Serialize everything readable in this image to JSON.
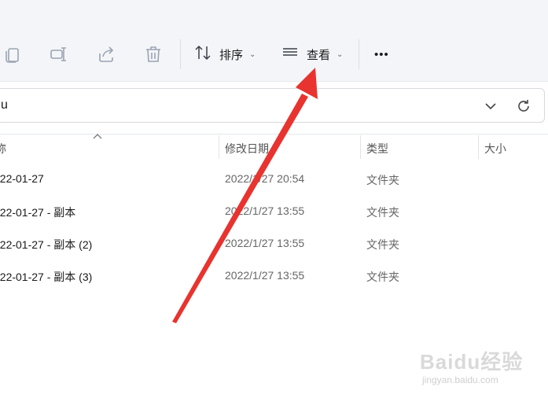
{
  "toolbar": {
    "sort_label": "排序",
    "view_label": "查看",
    "more_label": "•••"
  },
  "address_bar": {
    "path_text": "u"
  },
  "columns": {
    "name_label": "称",
    "date_label": "修改日期",
    "type_label": "类型",
    "size_label": "大小"
  },
  "files": [
    {
      "name": "022-01-27",
      "modified": "2022/1/27 20:54",
      "type": "文件夹"
    },
    {
      "name": "022-01-27 - 副本",
      "modified": "2022/1/27 13:55",
      "type": "文件夹"
    },
    {
      "name": "022-01-27 - 副本 (2)",
      "modified": "2022/1/27 13:55",
      "type": "文件夹"
    },
    {
      "name": "022-01-27 - 副本 (3)",
      "modified": "2022/1/27 13:55",
      "type": "文件夹"
    }
  ],
  "watermark": {
    "main": "Baidu经验",
    "sub": "jingyan.baidu.com"
  },
  "colors": {
    "toolbar_bg": "#f3f5f9",
    "arrow_red": "#e8332f",
    "icon_gray": "#8b95a6"
  }
}
